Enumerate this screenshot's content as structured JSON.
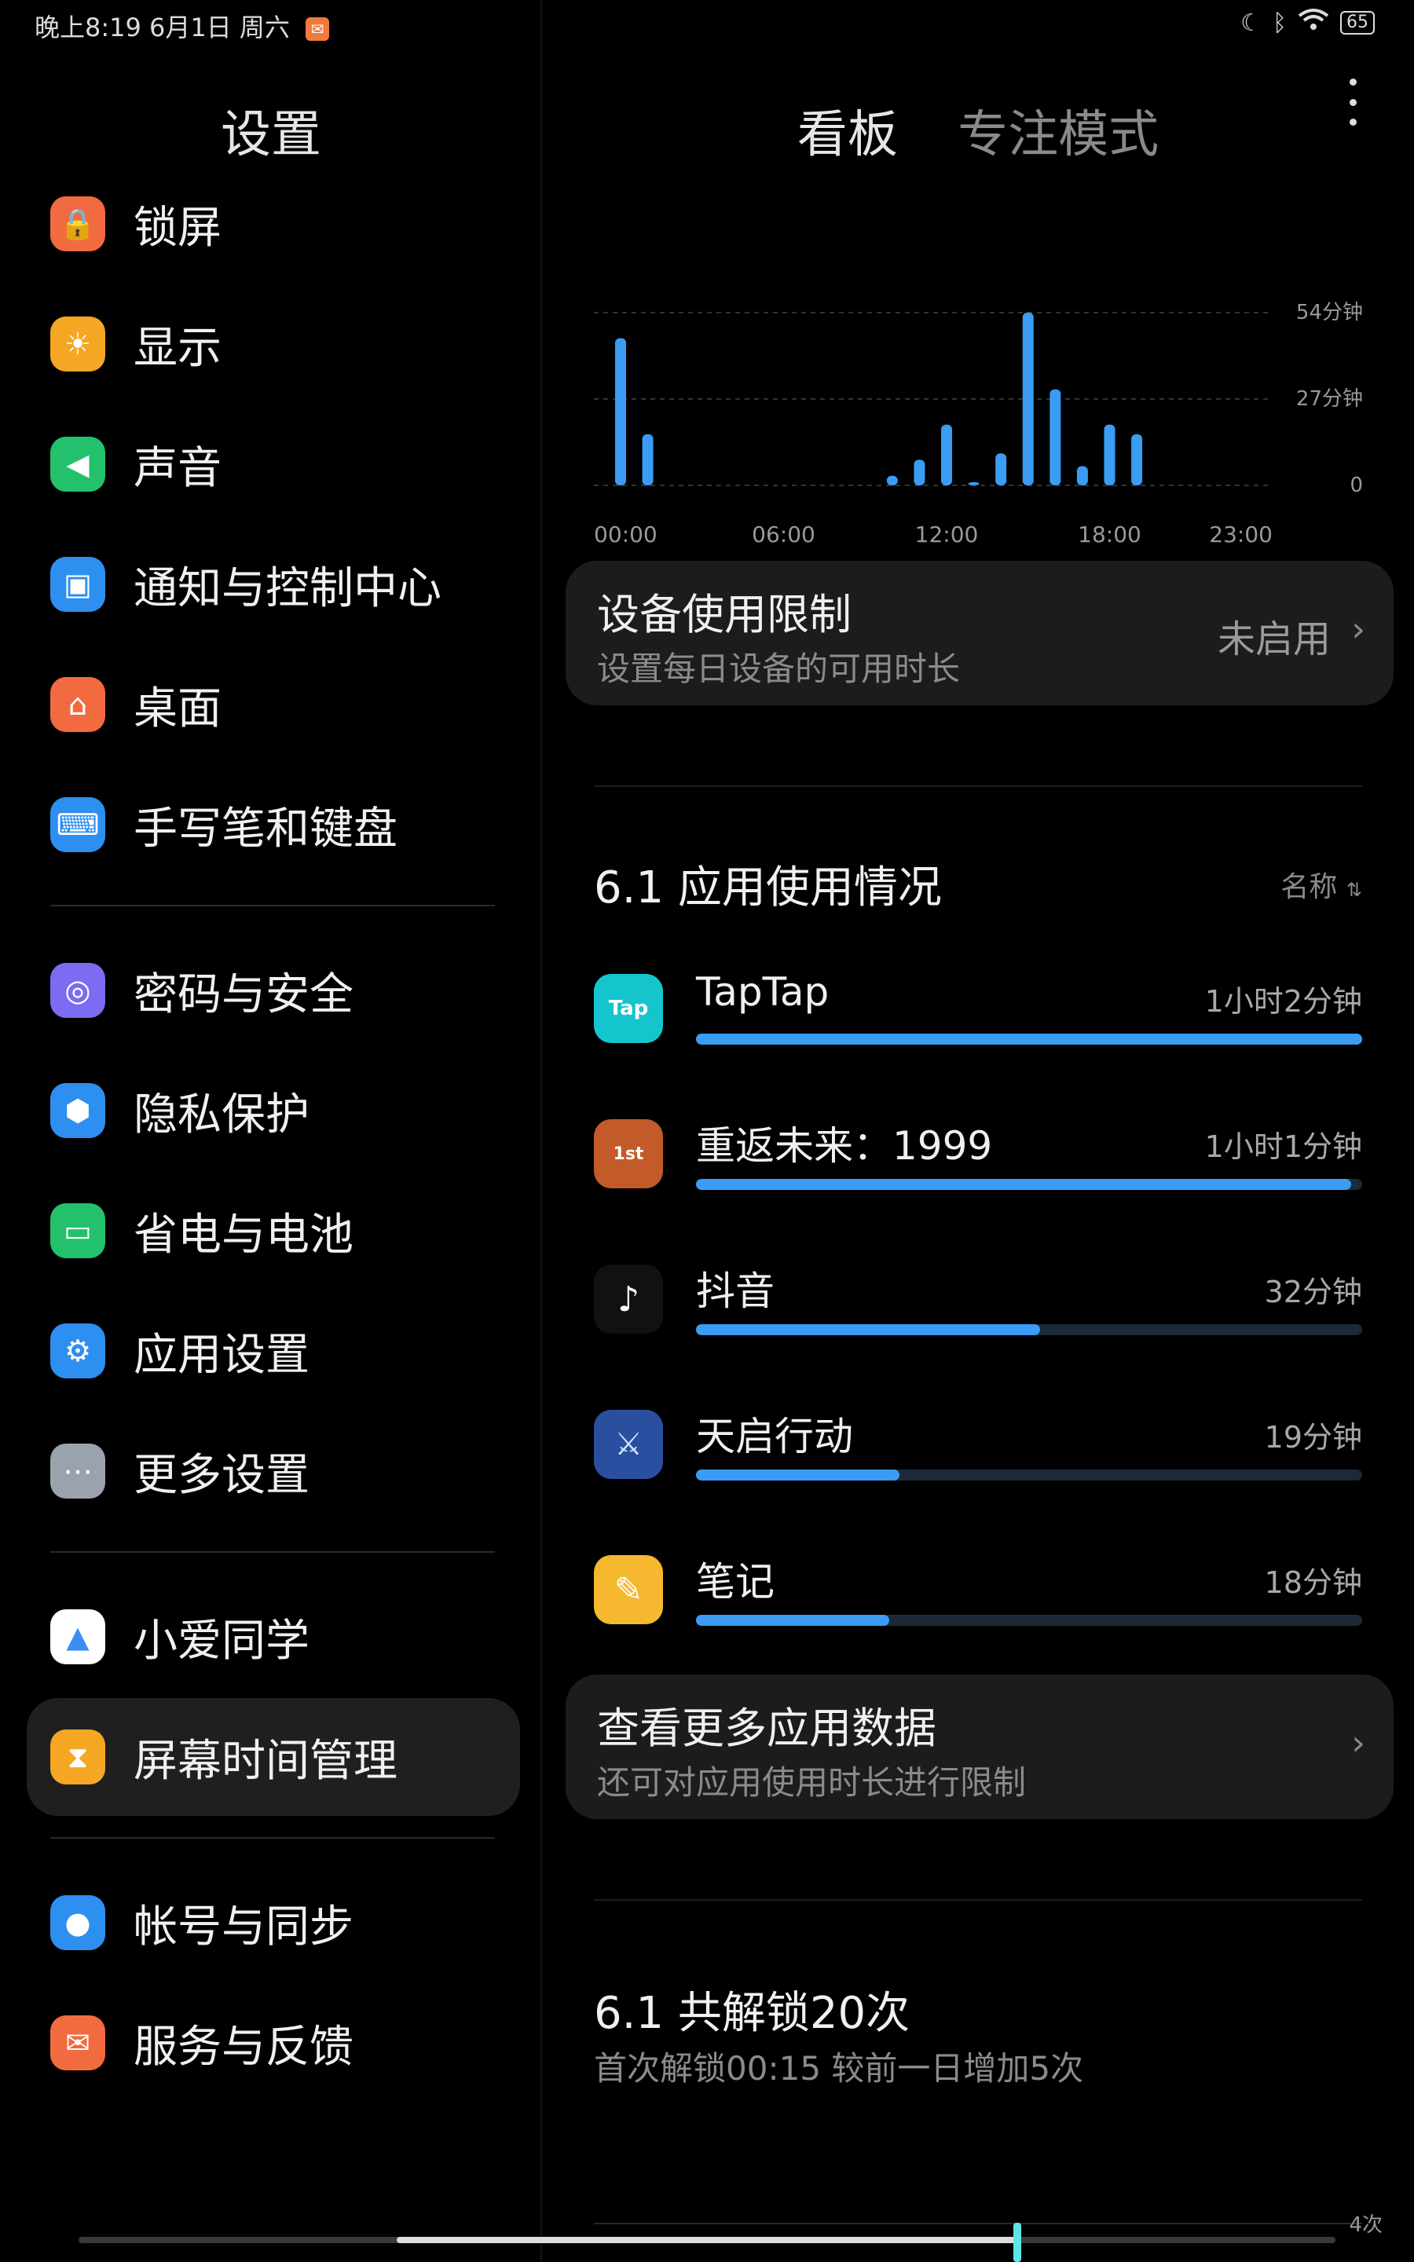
{
  "status_bar": {
    "time_date": "晚上8:19 6月1日 周六",
    "battery": "65"
  },
  "settings": {
    "title": "设置",
    "groups": [
      [
        {
          "label": "锁屏",
          "icon": "lock-icon",
          "color": "#f26a3f"
        },
        {
          "label": "显示",
          "icon": "sun-icon",
          "color": "#f5a623"
        },
        {
          "label": "声音",
          "icon": "speaker-icon",
          "color": "#23c16b"
        },
        {
          "label": "通知与控制中心",
          "icon": "notification-icon",
          "color": "#2d8ff0"
        },
        {
          "label": "桌面",
          "icon": "home-icon",
          "color": "#f26a3f"
        },
        {
          "label": "手写笔和键盘",
          "icon": "keyboard-icon",
          "color": "#2d8ff0"
        }
      ],
      [
        {
          "label": "密码与安全",
          "icon": "fingerprint-icon",
          "color": "#7b6cf2"
        },
        {
          "label": "隐私保护",
          "icon": "shield-icon",
          "color": "#2d8ff0"
        },
        {
          "label": "省电与电池",
          "icon": "battery-icon",
          "color": "#23c16b"
        },
        {
          "label": "应用设置",
          "icon": "gear-icon",
          "color": "#2d8ff0"
        },
        {
          "label": "更多设置",
          "icon": "more-dots-icon",
          "color": "#9aa3ad"
        }
      ],
      [
        {
          "label": "小爱同学",
          "icon": "xiaoai-icon",
          "color": "#ffffff"
        },
        {
          "label": "屏幕时间管理",
          "icon": "hourglass-icon",
          "color": "#f5a623",
          "active": true
        }
      ],
      [
        {
          "label": "帐号与同步",
          "icon": "account-icon",
          "color": "#2d8ff0"
        },
        {
          "label": "服务与反馈",
          "icon": "feedback-icon",
          "color": "#f26a3f"
        }
      ]
    ]
  },
  "tabs": {
    "dashboard": "看板",
    "focus": "专注模式"
  },
  "chart_data": {
    "type": "bar",
    "x_tick_labels": [
      "00:00",
      "06:00",
      "12:00",
      "18:00",
      "23:00"
    ],
    "y_tick_labels": [
      "54分钟",
      "27分钟",
      "0"
    ],
    "ylim": [
      0,
      54
    ],
    "hours": [
      0,
      1,
      10,
      11,
      12,
      13,
      14,
      15,
      16,
      17,
      18,
      19
    ],
    "values": [
      46,
      16,
      3,
      8,
      19,
      1,
      10,
      54,
      30,
      6,
      19,
      16
    ],
    "grid": true
  },
  "device_limit": {
    "title": "设备使用限制",
    "subtitle": "设置每日设备的可用时长",
    "status": "未启用"
  },
  "app_usage": {
    "title": "6.1 应用使用情况",
    "sort_label": "名称",
    "apps": [
      {
        "name": "TapTap",
        "time": "1小时2分钟",
        "fraction": 1.0,
        "icon": "taptap-icon"
      },
      {
        "name": "重返未来：1999",
        "time": "1小时1分钟",
        "fraction": 0.984,
        "icon": "reverse1999-icon"
      },
      {
        "name": "抖音",
        "time": "32分钟",
        "fraction": 0.516,
        "icon": "douyin-icon"
      },
      {
        "name": "天启行动",
        "time": "19分钟",
        "fraction": 0.306,
        "icon": "tianqi-icon"
      },
      {
        "name": "笔记",
        "time": "18分钟",
        "fraction": 0.29,
        "icon": "notes-icon"
      }
    ]
  },
  "more_data": {
    "title": "查看更多应用数据",
    "subtitle": "还可对应用使用时长进行限制"
  },
  "unlock": {
    "title": "6.1 共解锁20次",
    "subtitle": "首次解锁00:15   较前一日增加5次",
    "axis_top": "4次"
  }
}
